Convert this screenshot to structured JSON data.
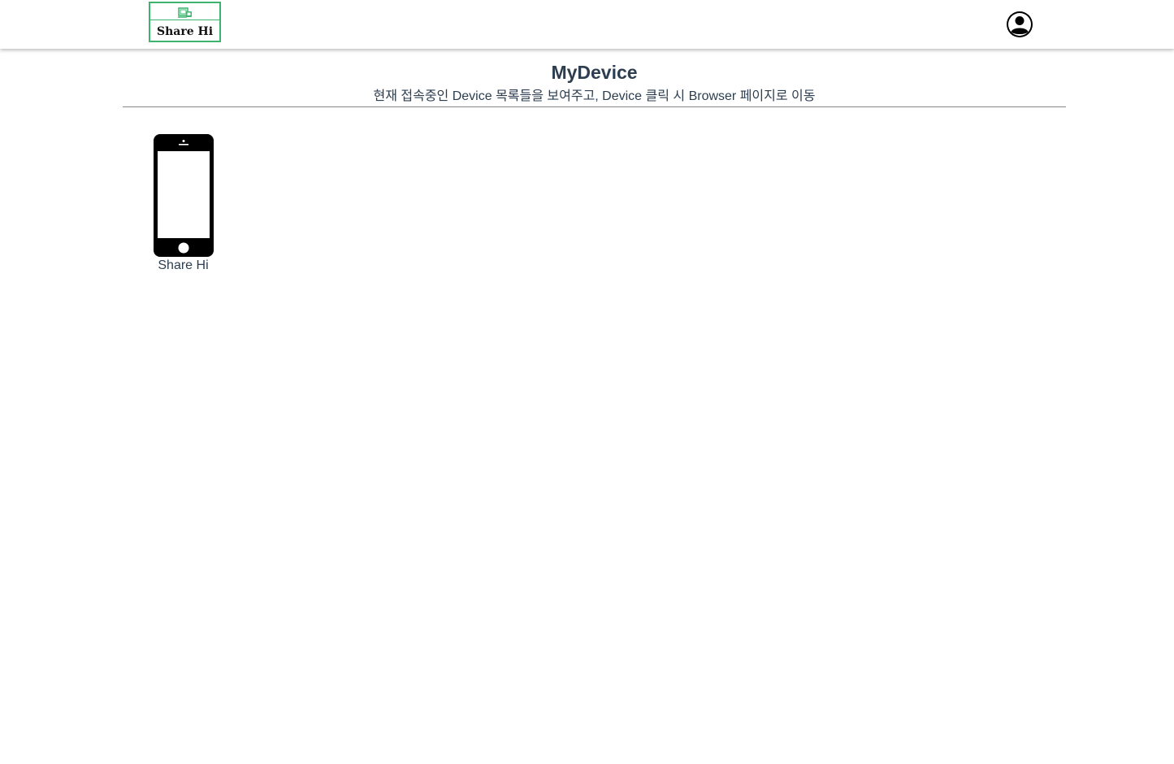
{
  "brand": {
    "logo_text": "Share Hi",
    "color": "#3cb46e",
    "icon": "devices-icon"
  },
  "user": {
    "icon": "account-circle-icon"
  },
  "header": {
    "title": "MyDevice",
    "subtitle": "현재 접속중인 Device 목록들을 보여주고, Device 클릭 시 Browser 페이지로 이동"
  },
  "devices": [
    {
      "name": "Share Hi",
      "icon": "smartphone-icon"
    }
  ]
}
